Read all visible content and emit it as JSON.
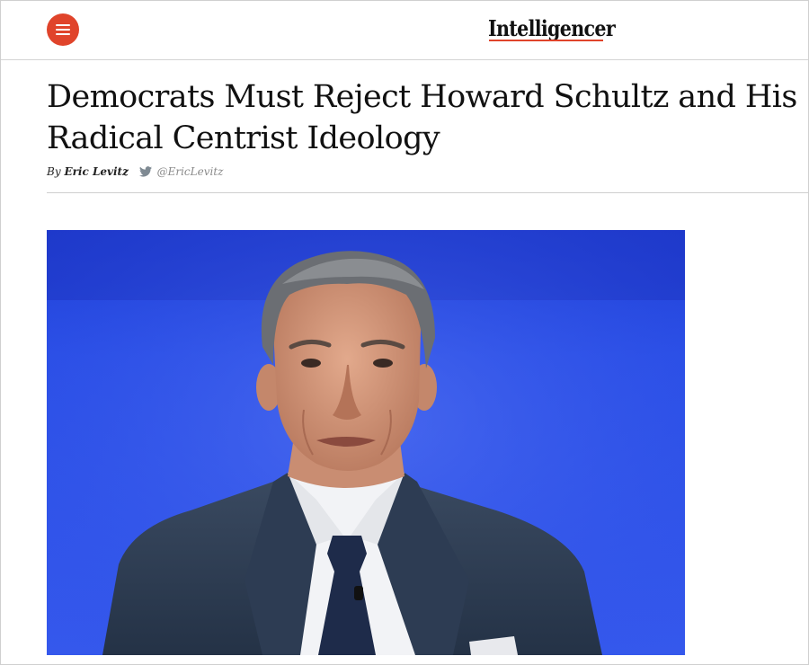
{
  "header": {
    "menu_icon": "hamburger-menu-icon",
    "logo_text": "Intelligencer",
    "accent_color": "#e0442b"
  },
  "article": {
    "headline": "Democrats Must Reject Howard Schultz and His Radical Centrist Ideology",
    "byline_prefix": "By",
    "author": "Eric Levitz",
    "twitter_icon": "twitter-bird-icon",
    "twitter_handle": "@EricLevitz"
  },
  "hero_image": {
    "subject": "photo-of-man-in-suit-against-blue-backdrop",
    "backdrop_color": "#2f4fe0"
  }
}
